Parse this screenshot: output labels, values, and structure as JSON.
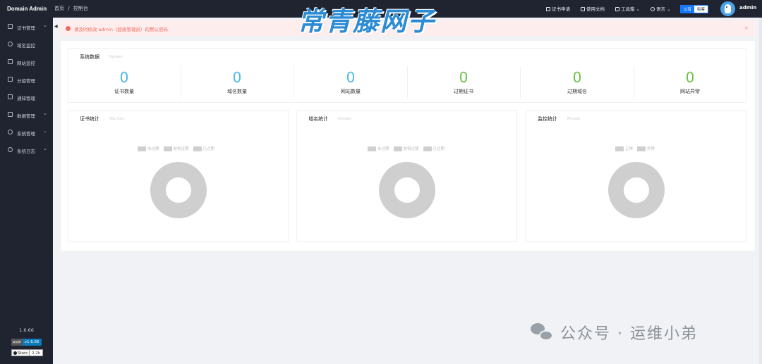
{
  "app": {
    "brand": "Domain Admin",
    "version": "1.6.66"
  },
  "breadcrumb": {
    "home": "首页",
    "separator": "/",
    "current": "控制台"
  },
  "header": {
    "links": [
      {
        "label": "证书申请",
        "icon": "edit-icon"
      },
      {
        "label": "使用文档",
        "icon": "document-icon"
      },
      {
        "label": "工具箱",
        "icon": "toolbox-icon"
      },
      {
        "label": "语言",
        "icon": "location-icon"
      }
    ],
    "toggle": {
      "active": "公有",
      "inactive": "吸客"
    },
    "user": "admin"
  },
  "sidebar": {
    "items": [
      {
        "label": "证书管理",
        "icon": "certificate-icon",
        "expandable": true
      },
      {
        "label": "域名监控",
        "icon": "database-icon",
        "expandable": false
      },
      {
        "label": "网站监控",
        "icon": "monitor-icon",
        "expandable": false
      },
      {
        "label": "分组管理",
        "icon": "folder-icon",
        "expandable": false
      },
      {
        "label": "通知管理",
        "icon": "mail-icon",
        "expandable": false
      },
      {
        "label": "数据管理",
        "icon": "briefcase-icon",
        "expandable": true
      },
      {
        "label": "系统管理",
        "icon": "gear-icon",
        "expandable": true
      },
      {
        "label": "系统日志",
        "icon": "clock-icon",
        "expandable": true
      }
    ],
    "badges": {
      "pypi": {
        "left": "pypi",
        "right": "v1.6.66"
      },
      "stars": {
        "left": "Stars",
        "right": "2.2k"
      }
    }
  },
  "alert": {
    "text": "请及时修改 admin（超级管理员）的默认密码",
    "close": "×"
  },
  "system": {
    "title": "系统数据",
    "subtitle": "System",
    "stats": [
      {
        "value": "0",
        "label": "证书数量",
        "color": "#4fb8e8"
      },
      {
        "value": "0",
        "label": "域名数量",
        "color": "#4fb8e8"
      },
      {
        "value": "0",
        "label": "网站数量",
        "color": "#4fb8e8"
      },
      {
        "value": "0",
        "label": "过期证书",
        "color": "#6cc24a"
      },
      {
        "value": "0",
        "label": "过期域名",
        "color": "#6cc24a"
      },
      {
        "value": "0",
        "label": "网站异常",
        "color": "#6cc24a"
      }
    ]
  },
  "charts": [
    {
      "title": "证书统计",
      "subtitle": "SSL Cert",
      "legend": [
        "未过期",
        "即将过期",
        "已过期"
      ]
    },
    {
      "title": "域名统计",
      "subtitle": "Domain",
      "legend": [
        "未过期",
        "即将过期",
        "已过期"
      ]
    },
    {
      "title": "监控统计",
      "subtitle": "Monitor",
      "legend": [
        "正常",
        "异常"
      ]
    }
  ],
  "watermarks": {
    "top": "常青藤网子",
    "bottom": "公众号 · 运维小弟"
  }
}
